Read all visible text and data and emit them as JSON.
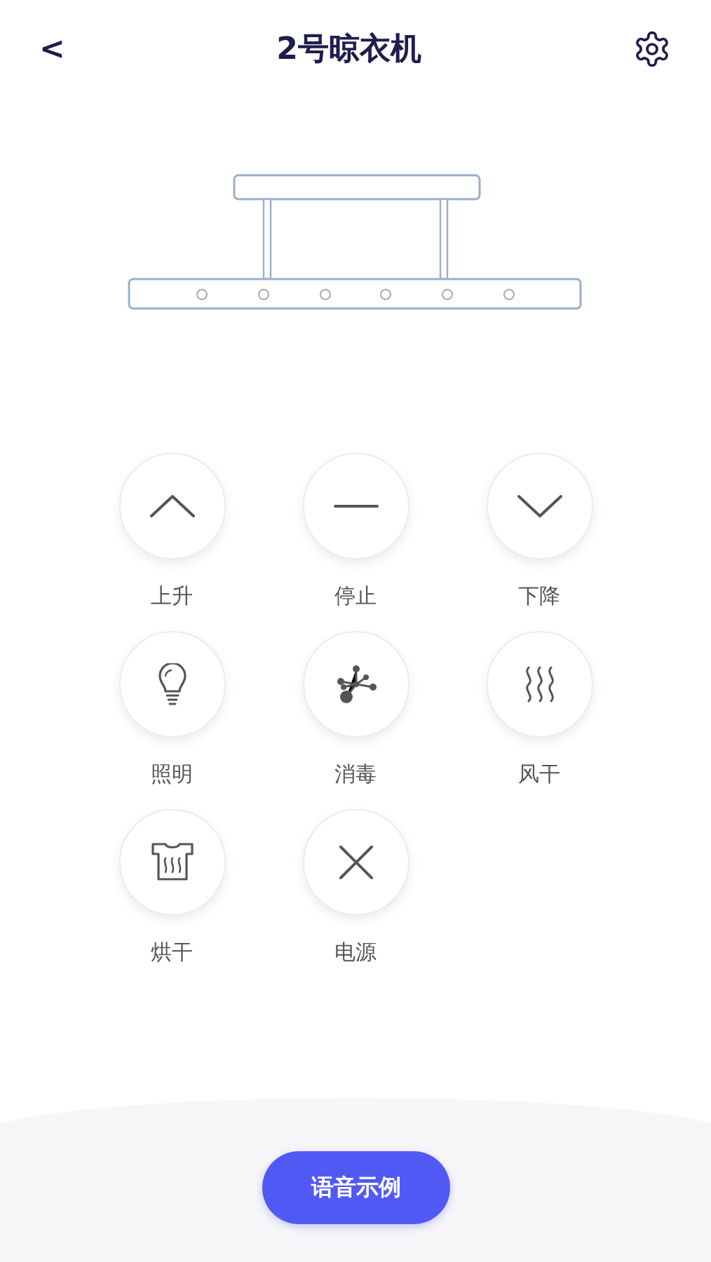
{
  "header": {
    "back": "<",
    "title": "2号晾衣机"
  },
  "controls": [
    {
      "kind": "up",
      "label": "上升"
    },
    {
      "kind": "stop",
      "label": "停止"
    },
    {
      "kind": "down",
      "label": "下降"
    },
    {
      "kind": "bulb",
      "label": "照明"
    },
    {
      "kind": "sterilize",
      "label": "消毒"
    },
    {
      "kind": "wind",
      "label": "风干"
    },
    {
      "kind": "dry",
      "label": "烘干"
    },
    {
      "kind": "power",
      "label": "电源"
    }
  ],
  "voice_button": "语音示例"
}
